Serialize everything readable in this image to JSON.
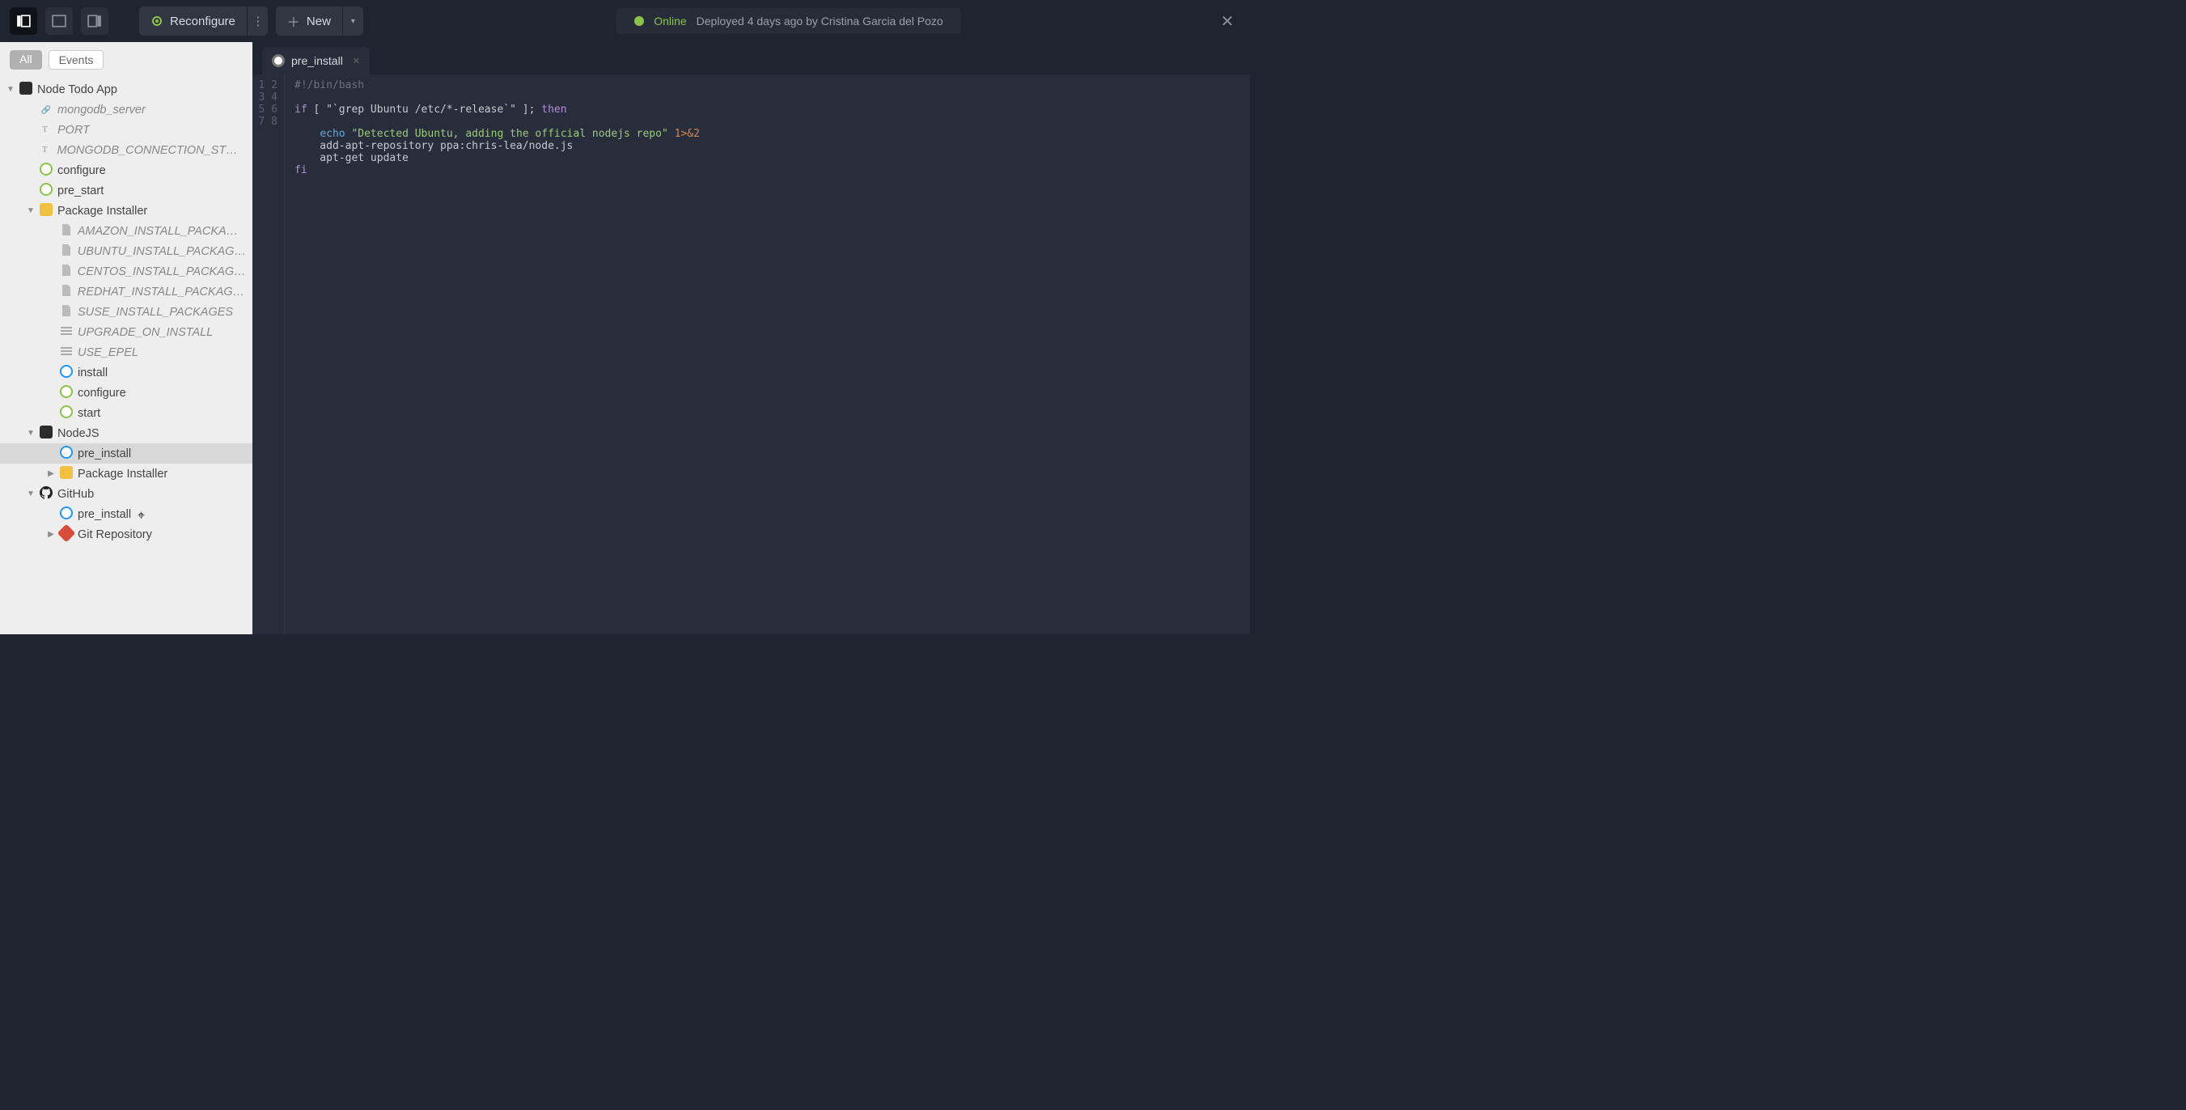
{
  "topbar": {
    "reconfigure": "Reconfigure",
    "new": "New",
    "status_label": "Online",
    "status_msg": "Deployed 4 days ago by Cristina Garcia del Pozo"
  },
  "sidebar": {
    "tabs": {
      "all": "All",
      "events": "Events"
    },
    "tree": [
      {
        "depth": 0,
        "caret": "down",
        "icon": "app",
        "label": "Node Todo App",
        "italic": false,
        "selected": false
      },
      {
        "depth": 1,
        "caret": "none",
        "icon": "link",
        "label": "mongodb_server",
        "italic": true,
        "selected": false
      },
      {
        "depth": 1,
        "caret": "none",
        "icon": "text",
        "label": "PORT",
        "italic": true,
        "selected": false
      },
      {
        "depth": 1,
        "caret": "none",
        "icon": "text",
        "label": "MONGODB_CONNECTION_STRING",
        "italic": true,
        "selected": false
      },
      {
        "depth": 1,
        "caret": "none",
        "icon": "tgreen",
        "label": "configure",
        "italic": false,
        "selected": false
      },
      {
        "depth": 1,
        "caret": "none",
        "icon": "tgreen",
        "label": "pre_start",
        "italic": false,
        "selected": false
      },
      {
        "depth": 1,
        "caret": "down",
        "icon": "pkg",
        "label": "Package Installer",
        "italic": false,
        "selected": false
      },
      {
        "depth": 2,
        "caret": "none",
        "icon": "file",
        "label": "AMAZON_INSTALL_PACKAGES",
        "italic": true,
        "selected": false
      },
      {
        "depth": 2,
        "caret": "none",
        "icon": "file",
        "label": "UBUNTU_INSTALL_PACKAGES",
        "italic": true,
        "selected": false
      },
      {
        "depth": 2,
        "caret": "none",
        "icon": "file",
        "label": "CENTOS_INSTALL_PACKAGES",
        "italic": true,
        "selected": false
      },
      {
        "depth": 2,
        "caret": "none",
        "icon": "file",
        "label": "REDHAT_INSTALL_PACKAGES",
        "italic": true,
        "selected": false
      },
      {
        "depth": 2,
        "caret": "none",
        "icon": "file",
        "label": "SUSE_INSTALL_PACKAGES",
        "italic": true,
        "selected": false
      },
      {
        "depth": 2,
        "caret": "none",
        "icon": "lines",
        "label": "UPGRADE_ON_INSTALL",
        "italic": true,
        "selected": false
      },
      {
        "depth": 2,
        "caret": "none",
        "icon": "lines",
        "label": "USE_EPEL",
        "italic": true,
        "selected": false
      },
      {
        "depth": 2,
        "caret": "none",
        "icon": "tblue",
        "label": "install",
        "italic": false,
        "selected": false
      },
      {
        "depth": 2,
        "caret": "none",
        "icon": "tgreen",
        "label": "configure",
        "italic": false,
        "selected": false
      },
      {
        "depth": 2,
        "caret": "none",
        "icon": "tgreen",
        "label": "start",
        "italic": false,
        "selected": false
      },
      {
        "depth": 1,
        "caret": "down",
        "icon": "node",
        "label": "NodeJS",
        "italic": false,
        "selected": false
      },
      {
        "depth": 2,
        "caret": "none",
        "icon": "tblue",
        "label": "pre_install",
        "italic": false,
        "selected": true
      },
      {
        "depth": 2,
        "caret": "right",
        "icon": "pkg",
        "label": "Package Installer",
        "italic": false,
        "selected": false
      },
      {
        "depth": 1,
        "caret": "down",
        "icon": "github",
        "label": "GitHub",
        "italic": false,
        "selected": false
      },
      {
        "depth": 2,
        "caret": "none",
        "icon": "tblue",
        "label": "pre_install",
        "italic": false,
        "selected": false
      },
      {
        "depth": 2,
        "caret": "right",
        "icon": "git",
        "label": "Git Repository",
        "italic": false,
        "selected": false
      }
    ]
  },
  "editor": {
    "tab_title": "pre_install",
    "line_numbers": [
      "1",
      "2",
      "3",
      "4",
      "5",
      "6",
      "7",
      "8"
    ],
    "code": {
      "l1": "#!/bin/bash",
      "l3_if": "if",
      "l3_cond": " [ \"`grep Ubuntu /etc/*-release`\" ]; ",
      "l3_then": "then",
      "l5_echo": "echo",
      "l5_str": " \"Detected Ubuntu, adding the official nodejs repo\" ",
      "l5_num": "1>&2",
      "l6": "    add-apt-repository ppa:chris-lea/node.js",
      "l7": "    apt-get update",
      "l8": "fi"
    }
  }
}
